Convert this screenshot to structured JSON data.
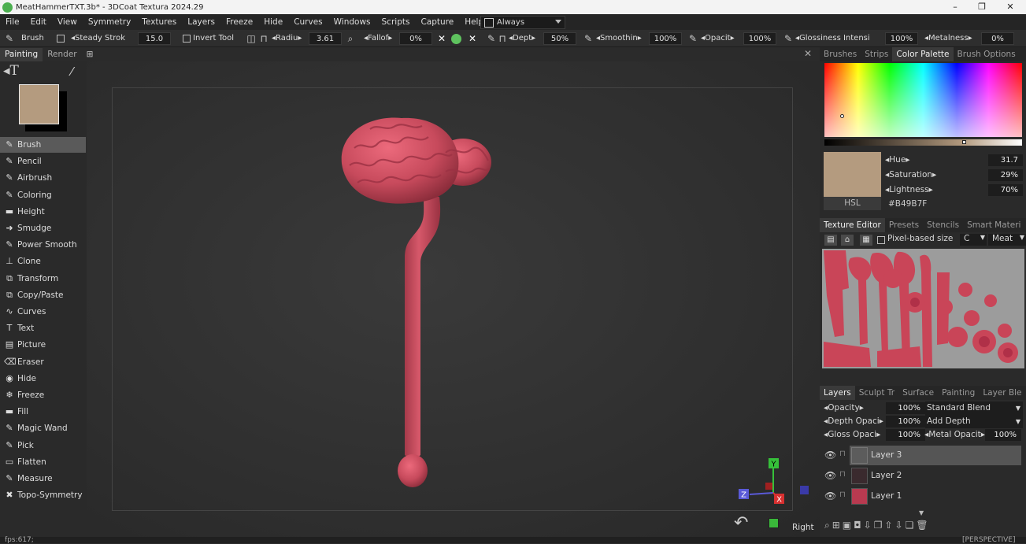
{
  "window": {
    "title": "MeatHammerTXT.3b* - 3DCoat Textura 2024.29",
    "buttons": [
      "–",
      "❐",
      "✕"
    ]
  },
  "menu": [
    "File",
    "Edit",
    "View",
    "Symmetry",
    "Textures",
    "Layers",
    "Freeze",
    "Hide",
    "Curves",
    "Windows",
    "Scripts",
    "Capture",
    "Help"
  ],
  "always_dropdown": "Always",
  "toolbar": {
    "brush_label": "Brush",
    "steady_stroke_label": "Steady Strok",
    "steady_stroke_value": "15.0",
    "invert_tool_label": "Invert Tool",
    "radius_label": "Radiu",
    "radius_value": "3.61",
    "falloff_label": "Fallof",
    "falloff_value": "0%",
    "depth_label": "Dept",
    "depth_value": "50%",
    "smoothing_label": "Smoothin",
    "smoothing_value": "100%",
    "opacity_label": "Opacit",
    "opacity_value": "100%",
    "glossiness_label": "Glossiness Intensi",
    "glossiness_value": "100%",
    "metalness_label": "Metalness",
    "metalness_value": "0%"
  },
  "left_tabs": [
    "Painting",
    "Render"
  ],
  "current_color": "#B49B7F",
  "tools": [
    "Brush",
    "Pencil",
    "Airbrush",
    "Coloring",
    "Height",
    "Smudge",
    "Power Smooth",
    "Clone",
    "Transform",
    "Copy/Paste",
    "Curves",
    "Text",
    "Picture",
    "Eraser",
    "Hide",
    "Freeze",
    "Fill",
    "Magic Wand",
    "Pick",
    "Flatten",
    "Measure",
    "Topo-Symmetry"
  ],
  "active_tool": "Brush",
  "viewport": {
    "view_name": "Right",
    "projection": "[PERSPECTIVE]",
    "axis": {
      "y": "Y",
      "x": "X",
      "z": "Z"
    }
  },
  "color_panel": {
    "tabs": [
      "Brushes",
      "Strips",
      "Color Palette",
      "Brush Options"
    ],
    "active_tab": "Color Palette",
    "hue_label": "Hue",
    "hue_value": "31.7",
    "saturation_label": "Saturation",
    "saturation_value": "29%",
    "lightness_label": "Lightness",
    "lightness_value": "70%",
    "mode_label": "HSL",
    "hex_value": "#B49B7F"
  },
  "texture_editor": {
    "tabs": [
      "Texture Editor",
      "Presets",
      "Stencils",
      "Smart Materi"
    ],
    "active_tab": "Texture Editor",
    "pixel_based_label": "Pixel-based",
    "size_label": "size",
    "channel_value": "C",
    "material_value": "Meat"
  },
  "layers_panel": {
    "tabs": [
      "Layers",
      "Sculpt Tr",
      "Surface",
      "Painting",
      "Layer Ble"
    ],
    "active_tab": "Layers",
    "opacity_label": "Opacity",
    "opacity_value": "100%",
    "blend_mode": "Standard Blend",
    "depth_opacity_label": "Depth Opaci",
    "depth_opacity_value": "100%",
    "depth_mode": "Add Depth",
    "gloss_opacity_label": "Gloss Opaci",
    "gloss_opacity_value": "100%",
    "metal_opacity_label": "Metal Opacit",
    "metal_opacity_value": "100%",
    "layers": [
      {
        "name": "Layer 3",
        "selected": true
      },
      {
        "name": "Layer 2",
        "selected": false
      },
      {
        "name": "Layer 1",
        "selected": false
      }
    ]
  },
  "status": {
    "fps": "fps:617;"
  }
}
